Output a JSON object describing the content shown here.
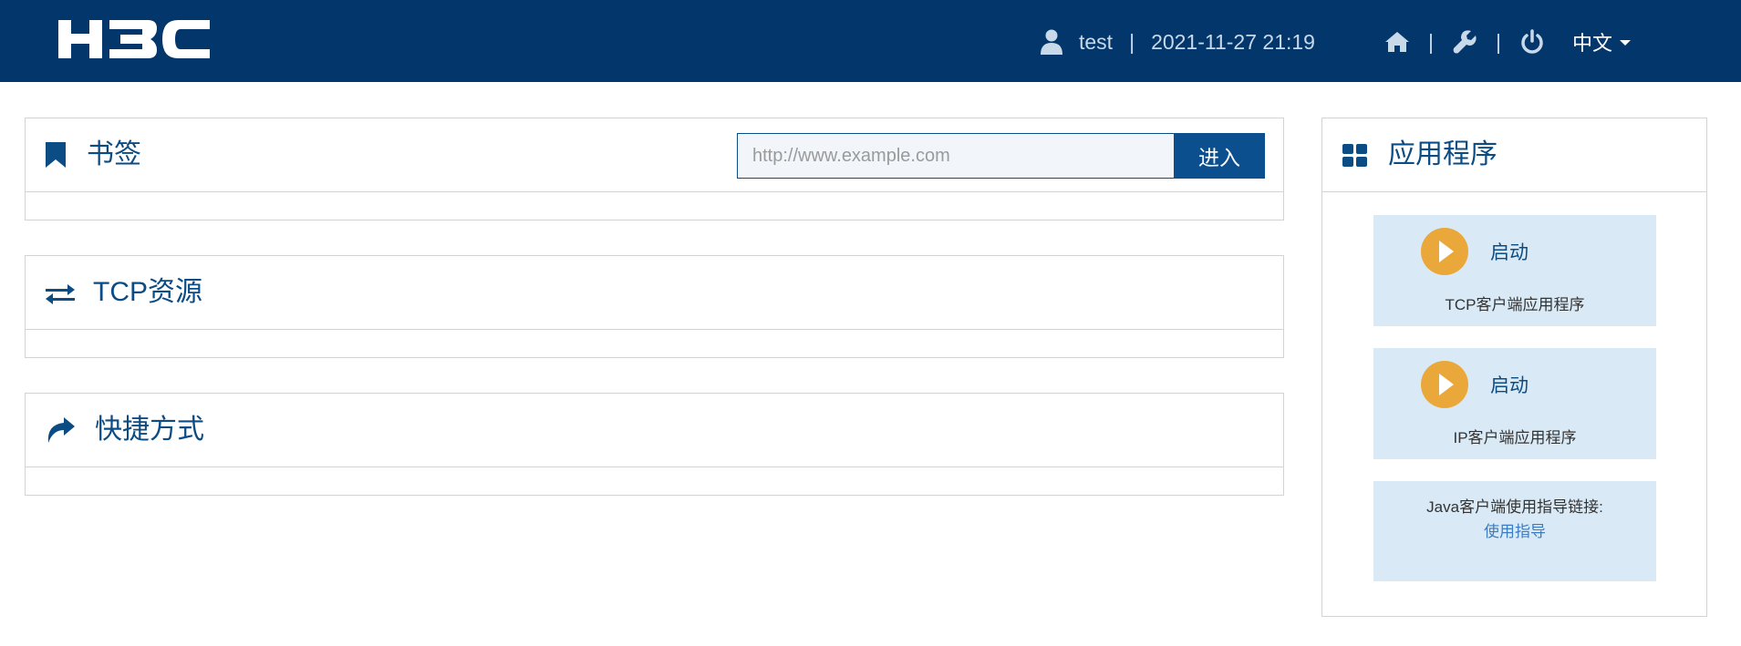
{
  "header": {
    "logo_text": "H3C",
    "user": {
      "name": "test",
      "datetime": "2021-11-27 21:19"
    },
    "separator": "|",
    "icons": [
      "home-icon",
      "wrench-icon",
      "power-icon"
    ],
    "language": "中文"
  },
  "bookmarks": {
    "title": "书签",
    "icon": "bookmark-icon",
    "url_placeholder": "http://www.example.com",
    "enter_label": "进入"
  },
  "tcp_resources": {
    "title": "TCP资源",
    "icon": "exchange-arrows-icon"
  },
  "shortcuts": {
    "title": "快捷方式",
    "icon": "share-arrow-icon"
  },
  "applications": {
    "title": "应用程序",
    "icon": "grid-icon",
    "cards": [
      {
        "launch_label": "启动",
        "caption": "TCP客户端应用程序"
      },
      {
        "launch_label": "启动",
        "caption": "IP客户端应用程序"
      }
    ],
    "java_guide": {
      "text": "Java客户端使用指导链接:",
      "link_label": "使用指导"
    }
  },
  "colors": {
    "header_bg": "#03366b",
    "accent": "#0c4c84",
    "button_bg": "#0b4f8e",
    "card_bg": "#d9eaf6",
    "play_orange": "#eaa83a",
    "link": "#3b7cc4"
  }
}
